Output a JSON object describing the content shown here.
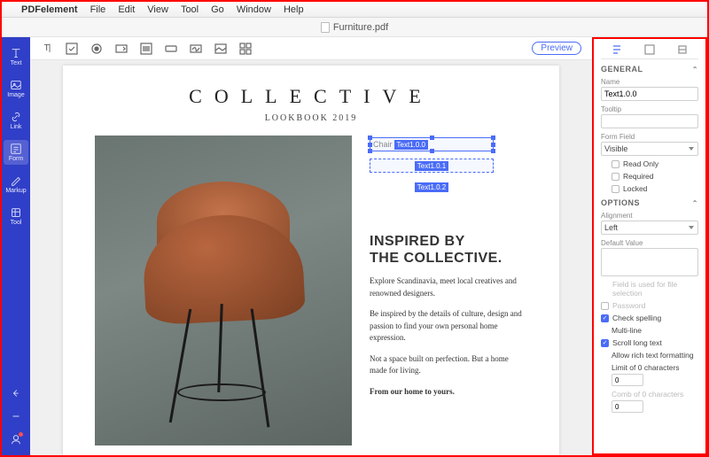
{
  "menubar": {
    "app": "PDFelement",
    "items": [
      "File",
      "Edit",
      "View",
      "Tool",
      "Go",
      "Window",
      "Help"
    ]
  },
  "titlebar": {
    "doc": "Furniture.pdf"
  },
  "sidebar": {
    "items": [
      {
        "label": "Text"
      },
      {
        "label": "Image"
      },
      {
        "label": "Link"
      },
      {
        "label": "Form"
      },
      {
        "label": "Markup"
      },
      {
        "label": "Tool"
      }
    ]
  },
  "toolbar": {
    "preview": "Preview"
  },
  "document": {
    "title": "COLLECTIVE",
    "subtitle": "LOOKBOOK 2019",
    "fields": [
      {
        "demo": "Chair",
        "tag": "Text1.0.0",
        "selected": true
      },
      {
        "demo": "",
        "tag": "Text1.0.1",
        "selected": false
      },
      {
        "demo": "",
        "tag": "Text1.0.2",
        "selected": false
      }
    ],
    "headline1": "INSPIRED BY",
    "headline2": "THE COLLECTIVE.",
    "p1": "Explore Scandinavia, meet local creatives and renowned designers.",
    "p2": "Be inspired by the details of culture, design and passion to find your own personal home expression.",
    "p3": "Not a space built on perfection. But a home made for living.",
    "p4": "From our home to yours."
  },
  "panel": {
    "general": {
      "title": "GENERAL",
      "name_label": "Name",
      "name_value": "Text1.0.0",
      "tooltip_label": "Tooltip",
      "tooltip_value": "",
      "formfield_label": "Form Field",
      "formfield_value": "Visible",
      "readonly": "Read Only",
      "required": "Required",
      "locked": "Locked"
    },
    "options": {
      "title": "OPTIONS",
      "align_label": "Alignment",
      "align_value": "Left",
      "default_label": "Default Value",
      "default_value": "",
      "file_sel": "Field is used for file selection",
      "password": "Password",
      "spell": "Check spelling",
      "multiline": "Multi-line",
      "scroll": "Scroll long text",
      "rich": "Allow rich text formatting",
      "limit": "Limit of 0 characters",
      "limit_val": "0",
      "comb": "Comb of 0 characters",
      "comb_val": "0"
    }
  }
}
